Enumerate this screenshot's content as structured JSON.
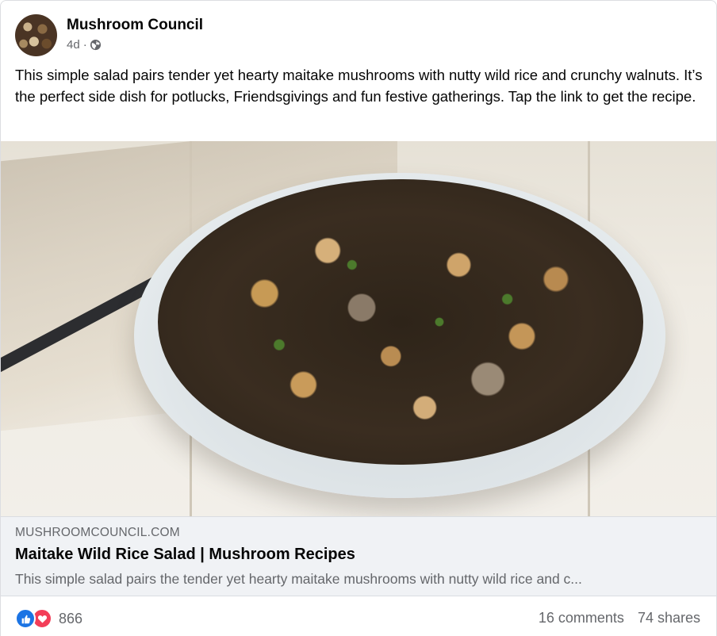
{
  "post": {
    "page_name": "Mushroom Council",
    "time": "4d",
    "separator": "·",
    "privacy_icon": "globe-icon",
    "caption": "This simple salad pairs tender yet hearty maitake mushrooms with nutty wild rice and crunchy walnuts. It’s the perfect side dish for potlucks, Friendsgivings and fun festive gatherings. Tap the link to get the recipe."
  },
  "link_preview": {
    "domain": "MUSHROOMCOUNCIL.COM",
    "title": "Maitake Wild Rice Salad | Mushroom Recipes",
    "description": "This simple salad pairs the tender yet hearty maitake mushrooms with nutty wild rice and c..."
  },
  "engagement": {
    "reaction_icons": [
      "like-icon",
      "love-icon"
    ],
    "reaction_count": "866",
    "comments": "16 comments",
    "shares": "74 shares"
  },
  "colors": {
    "like": "#1b74e4",
    "love": "#f33e58",
    "secondary_text": "#65676b",
    "link_box_bg": "#f0f2f5"
  }
}
